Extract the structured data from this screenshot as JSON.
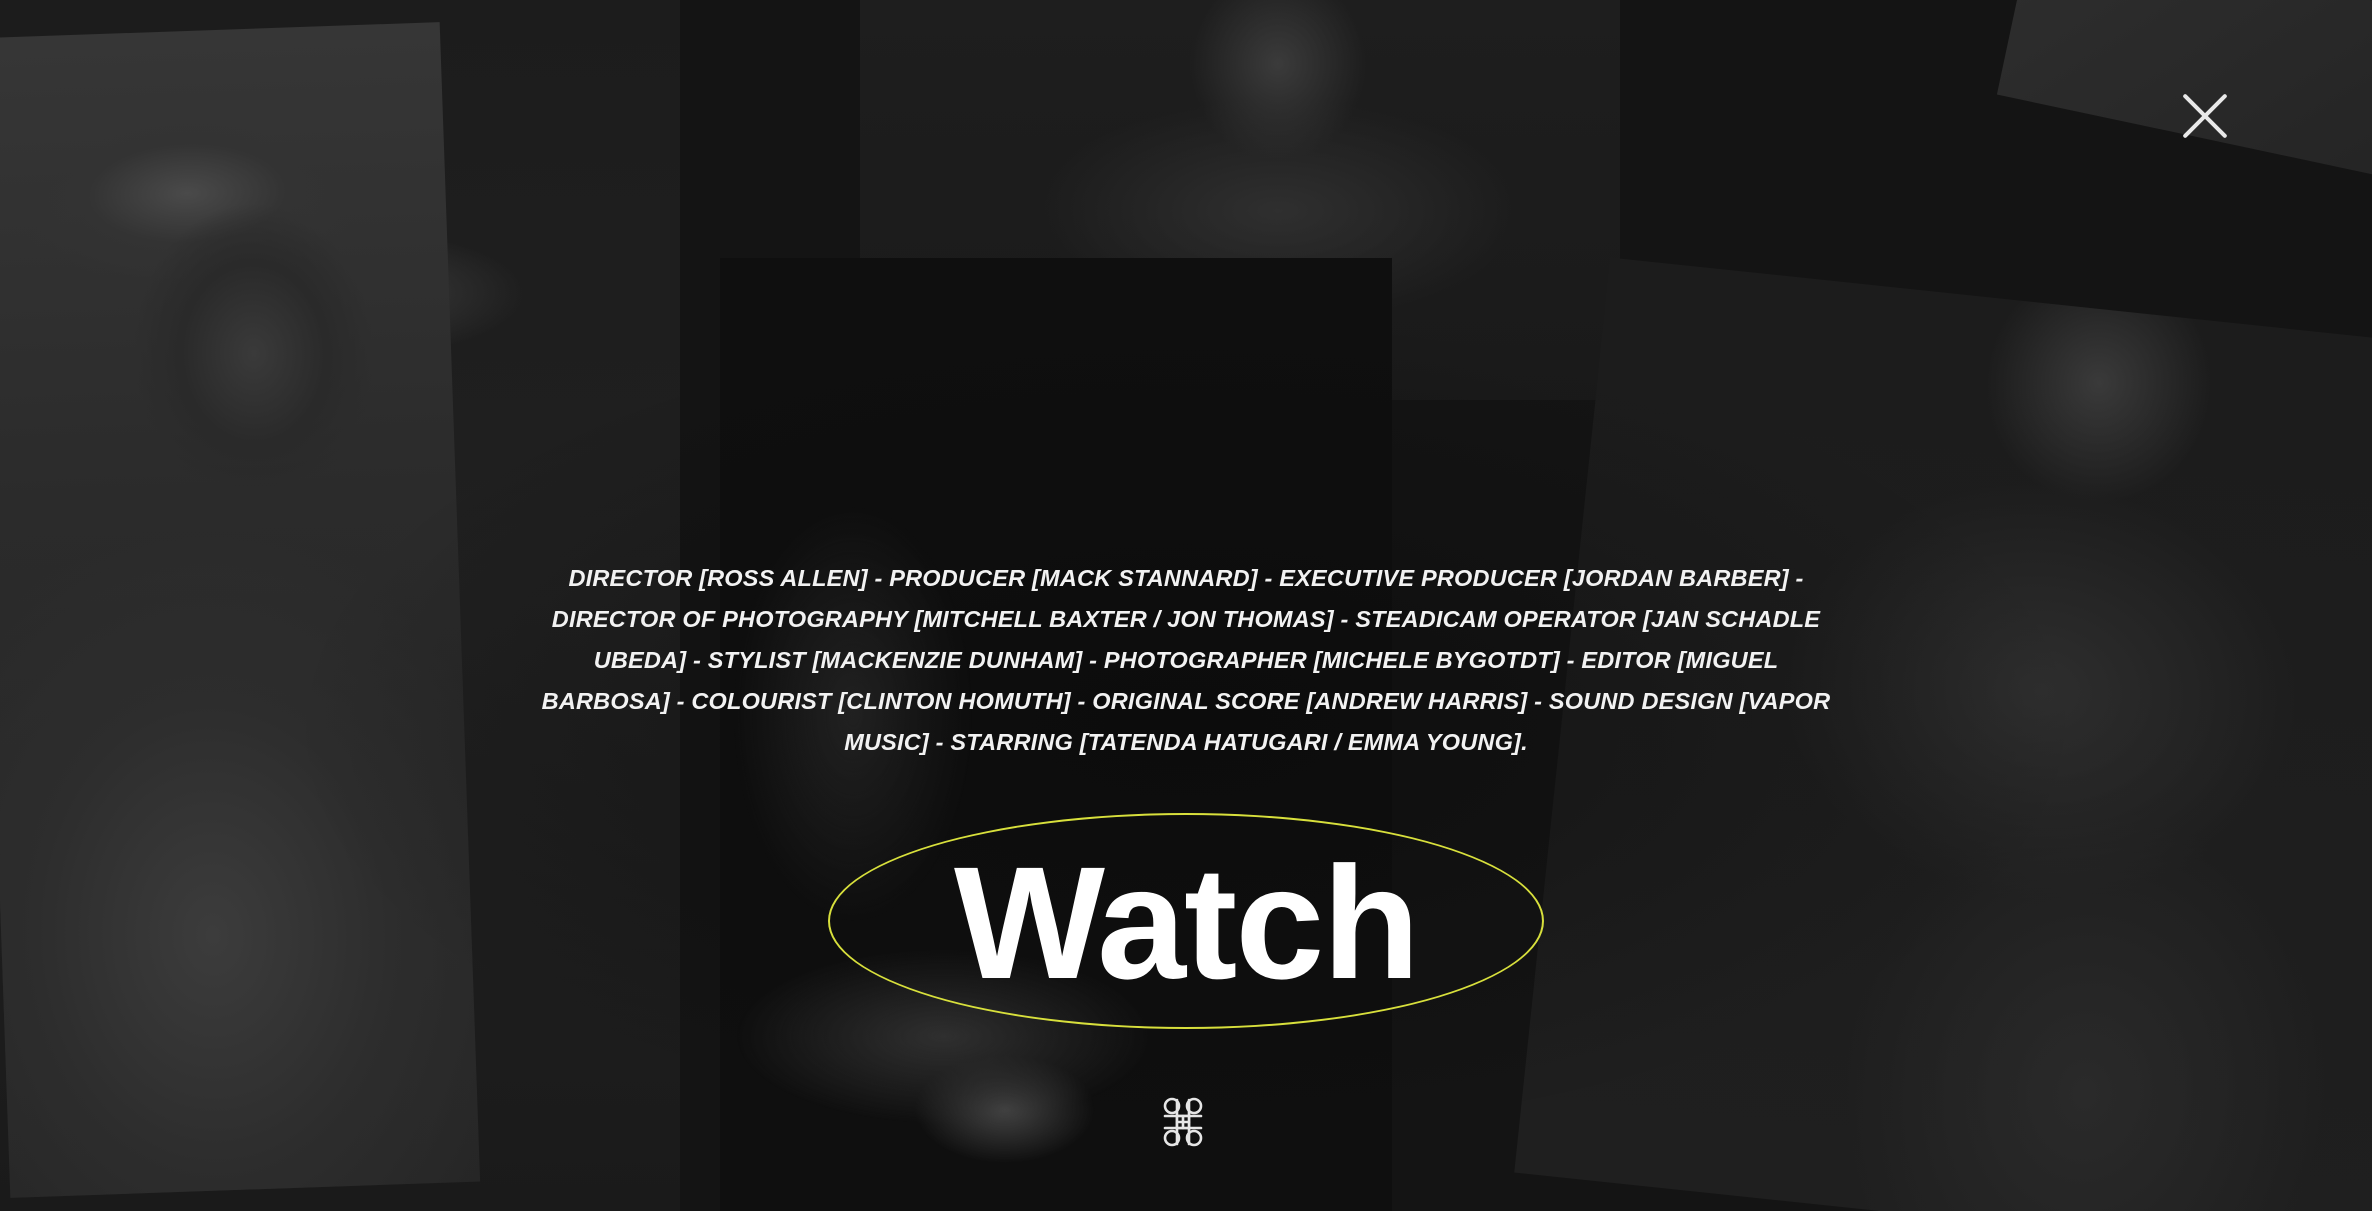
{
  "credits_text": "DIRECTOR [ROSS ALLEN] - PRODUCER [MACK STANNARD] - EXECUTIVE PRODUCER [JORDAN BARBER] - DIRECTOR OF PHOTOGRAPHY [MITCHELL BAXTER / JON THOMAS] - STEADICAM OPERATOR [JAN SCHADLE UBEDA] - STYLIST [MACKENZIE DUNHAM] - PHOTOGRAPHER [MICHELE BYGOTDT] - EDITOR [MIGUEL BARBOSA] - COLOURIST [CLINTON HOMUTH] - ORIGINAL SCORE [ANDREW HARRIS] - SOUND DESIGN [VAPOR MUSIC] - STARRING [TATENDA HATUGARI / EMMA YOUNG].",
  "watch_button": {
    "label": "Watch",
    "outline_color": "#d8e03c"
  },
  "icons": {
    "close": "close-icon",
    "logo": "knot-logo-icon"
  },
  "colors": {
    "background": "#141414",
    "text": "#f2f2f2",
    "accent": "#d8e03c"
  }
}
